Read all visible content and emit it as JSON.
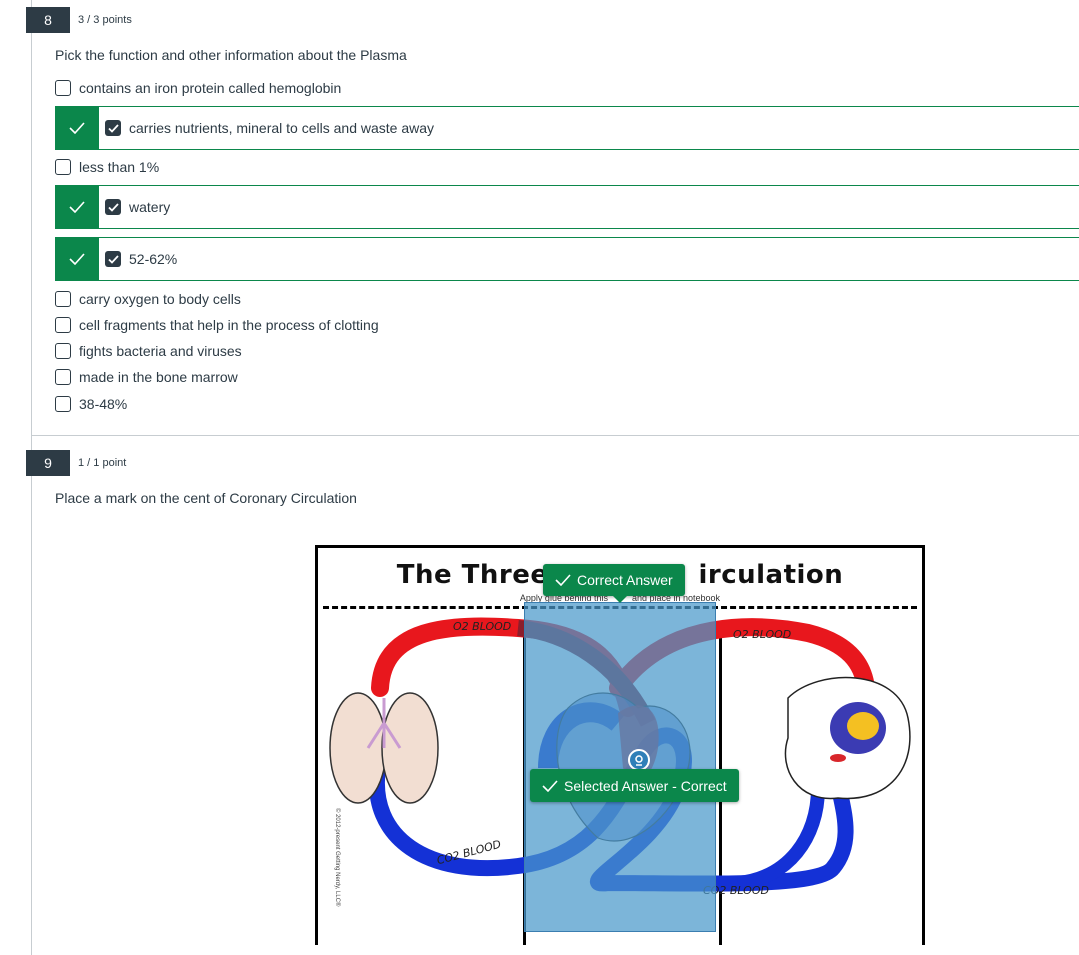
{
  "questions": [
    {
      "number": "8",
      "points": "3 / 3 points",
      "prompt": "Pick the function and other information about the Plasma",
      "answers": [
        {
          "label": "contains an iron protein called  hemoglobin",
          "selected": false,
          "correct_marked": false
        },
        {
          "label": "carries nutrients, mineral to cells and waste away",
          "selected": true,
          "correct_marked": true
        },
        {
          "label": "less than 1%",
          "selected": false,
          "correct_marked": false
        },
        {
          "label": "watery",
          "selected": true,
          "correct_marked": true
        },
        {
          "label": "52-62%",
          "selected": true,
          "correct_marked": true
        },
        {
          "label": "carry oxygen to body cells",
          "selected": false,
          "correct_marked": false
        },
        {
          "label": "cell fragments that help in the process of clotting",
          "selected": false,
          "correct_marked": false
        },
        {
          "label": "fights bacteria and viruses",
          "selected": false,
          "correct_marked": false
        },
        {
          "label": "made in the bone marrow",
          "selected": false,
          "correct_marked": false
        },
        {
          "label": "38-48%",
          "selected": false,
          "correct_marked": false
        }
      ]
    },
    {
      "number": "9",
      "points": "1 / 1 point",
      "prompt": "Place a mark on the cent of Coronary Circulation",
      "diagram": {
        "title_left": "The Three",
        "title_right": "irculation",
        "subtitle_left": "Apply glue behind this",
        "subtitle_right": "and place in notebook",
        "labels": {
          "o2_left": "O2 BLOOD",
          "o2_right": "O2 BLOOD",
          "co2_left": "CO2 BLOOD",
          "co2_right": "CO2 BLOOD"
        },
        "copyright": "© 2012-present Getting Nerdy, LLC®"
      },
      "correct_answer_label": "Correct Answer",
      "selected_answer_label": "Selected Answer - Correct"
    }
  ],
  "colors": {
    "correct_green": "#0b874b",
    "question_number_bg": "#2d3b45",
    "answer_region": "#4a99cb",
    "oxygenated_blood": "#e8171d",
    "deoxygenated_blood": "#1431d6"
  }
}
